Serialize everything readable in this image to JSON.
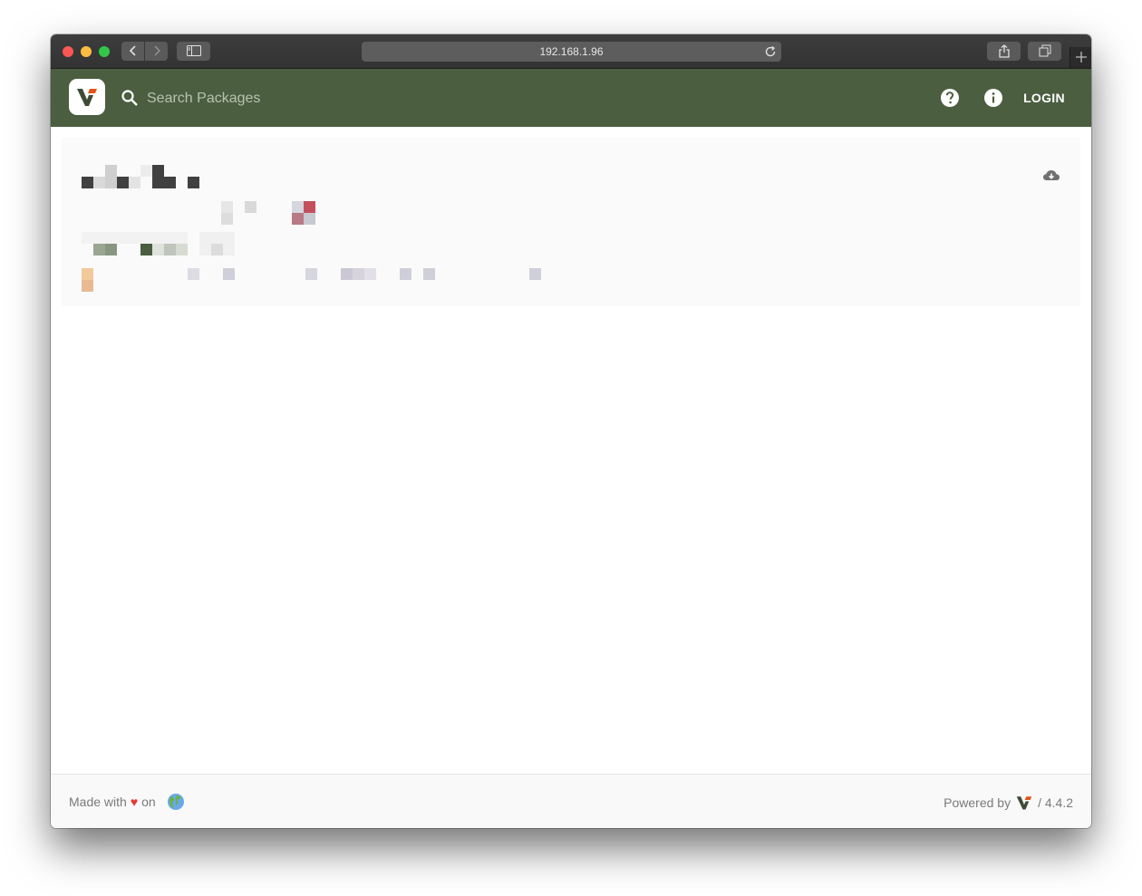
{
  "browser": {
    "url": "192.168.1.96"
  },
  "header": {
    "search_placeholder": "Search Packages",
    "login_label": "LOGIN",
    "brand_color": "#4b5e40"
  },
  "footer": {
    "made_with": "Made with",
    "on": "on",
    "heart": "♥",
    "powered_by": "Powered by",
    "version": "/ 4.4.2"
  }
}
